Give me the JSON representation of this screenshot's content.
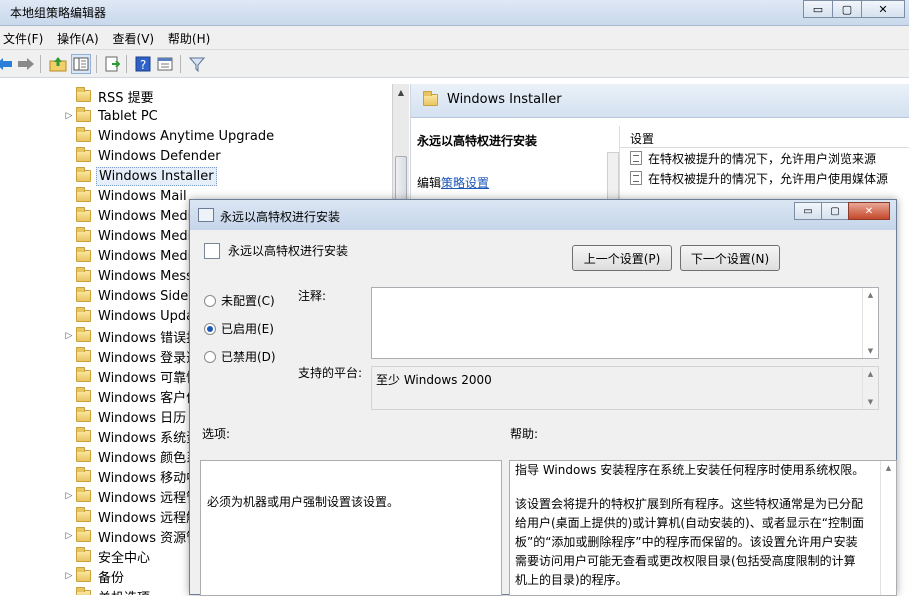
{
  "window": {
    "title": "本地组策略编辑器",
    "min": "▭",
    "max": "▢",
    "close": "✕"
  },
  "menu": [
    "文件(F)",
    "操作(A)",
    "查看(V)",
    "帮助(H)"
  ],
  "toolbar_icons": [
    "back-arrow-icon",
    "forward-arrow-icon",
    "up-folder-icon",
    "show-hide-tree-icon",
    "export-list-icon",
    "help-icon",
    "properties-icon",
    "filter-icon"
  ],
  "tree": {
    "items": [
      {
        "label": "RSS 提要",
        "expandable": false
      },
      {
        "label": "Tablet PC",
        "expandable": true
      },
      {
        "label": "Windows Anytime Upgrade",
        "expandable": false
      },
      {
        "label": "Windows Defender",
        "expandable": false
      },
      {
        "label": "Windows Installer",
        "expandable": false,
        "selected": true
      },
      {
        "label": "Windows Mail",
        "expandable": false
      },
      {
        "label": "Windows Media",
        "expandable": false
      },
      {
        "label": "Windows Media",
        "expandable": false
      },
      {
        "label": "Windows Media",
        "expandable": false
      },
      {
        "label": "Windows Messe",
        "expandable": false
      },
      {
        "label": "Windows SideSh",
        "expandable": false
      },
      {
        "label": "Windows Updat",
        "expandable": false
      },
      {
        "label": "Windows 错误报",
        "expandable": true
      },
      {
        "label": "Windows 登录选",
        "expandable": false
      },
      {
        "label": "Windows 可靠性",
        "expandable": false
      },
      {
        "label": "Windows 客户体",
        "expandable": false
      },
      {
        "label": "Windows 日历",
        "expandable": false
      },
      {
        "label": "Windows 系统资",
        "expandable": false
      },
      {
        "label": "Windows 颜色系",
        "expandable": false
      },
      {
        "label": "Windows 移动中",
        "expandable": false
      },
      {
        "label": "Windows 远程管",
        "expandable": true
      },
      {
        "label": "Windows 远程解",
        "expandable": false
      },
      {
        "label": "Windows 资源管",
        "expandable": true
      },
      {
        "label": "安全中心",
        "expandable": false
      },
      {
        "label": "备份",
        "expandable": true
      },
      {
        "label": "关机选项",
        "expandable": false
      }
    ]
  },
  "right": {
    "header": "Windows Installer",
    "policy_title": "永远以高特权进行安装",
    "edit_prefix": "编辑",
    "edit_link": "策略设置",
    "list_header": "设置",
    "rows": [
      "在特权被提升的情况下，允许用户浏览来源",
      "在特权被提升的情况下，允许用户使用媒体源"
    ]
  },
  "dialog": {
    "title": "永远以高特权进行安装",
    "policy_name": "永远以高特权进行安装",
    "prev_button": "上一个设置(P)",
    "next_button": "下一个设置(N)",
    "radios": [
      {
        "label": "未配置(C)",
        "checked": false
      },
      {
        "label": "已启用(E)",
        "checked": true
      },
      {
        "label": "已禁用(D)",
        "checked": false
      }
    ],
    "comment_label": "注释:",
    "platform_label": "支持的平台:",
    "platform_value": "至少 Windows 2000",
    "options_label": "选项:",
    "help_label": "帮助:",
    "options_text": "必须为机器或用户强制设置该设置。",
    "help_p1": "指导 Windows 安装程序在系统上安装任何程序时使用系统权限。",
    "help_p2": "该设置会将提升的特权扩展到所有程序。这些特权通常是为已分配给用户(桌面上提供的)或计算机(自动安装的)、或者显示在“控制面板”的“添加或删除程序”中的程序而保留的。该设置允许用户安装需要访问用户可能无查看或更改权限目录(包括受高度限制的计算机上的目录)的程序。"
  }
}
